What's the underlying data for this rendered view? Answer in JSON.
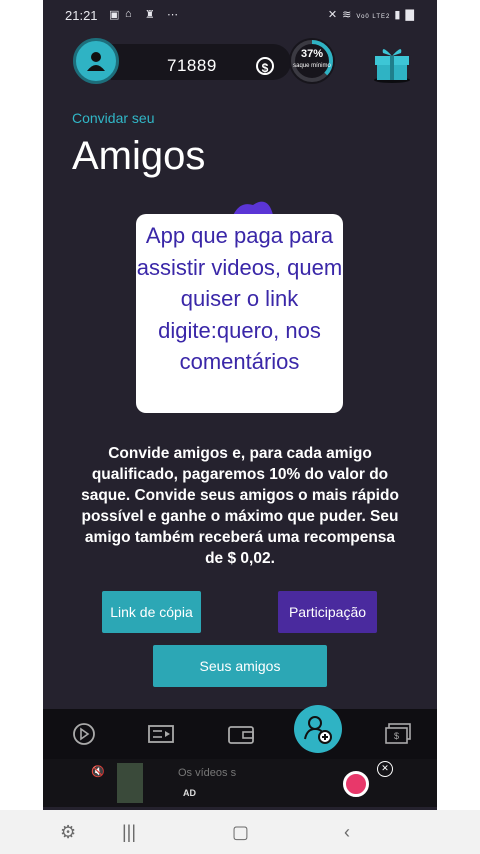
{
  "status_bar": {
    "time": "21:21",
    "notification_icons": [
      "gallery-icon",
      "vpn-icon",
      "person-icon",
      "more-icon"
    ],
    "network_label": "Vo0 LTE2",
    "system_icons": [
      "mute-icon",
      "wifi-icon",
      "signal-icon",
      "battery-icon"
    ]
  },
  "header": {
    "coin_balance": "71889",
    "currency_symbol": "$",
    "withdraw_progress": {
      "percent_label": "37%",
      "value": 0.37,
      "caption": "saque mínimo"
    }
  },
  "invite": {
    "small_title": "Convidar seu",
    "big_title": "Amigos"
  },
  "overlay_text": "App que paga para assistir videos, quem quiser o link digite:quero, nos comentários",
  "description": "Convide amigos e, para cada amigo qualificado, pagaremos 10% do valor do saque. Convide seus amigos o mais rápido possível e ganhe o máximo que puder. Seu amigo também receberá uma recompensa de $ 0,02.",
  "buttons": {
    "copy_link": "Link de cópia",
    "participation": "Participação",
    "your_friends": "Seus amigos"
  },
  "bottom_nav": {
    "items": [
      "play-icon",
      "video-list-icon",
      "wallet-icon",
      "add-friend-icon",
      "cash-icon"
    ],
    "active": "add-friend-icon"
  },
  "ad": {
    "title": "Os vídeos s",
    "label": "AD"
  },
  "colors": {
    "background": "#25222e",
    "accent_teal": "#2fb3c4",
    "accent_purple": "#4a2a9e",
    "overlay_text": "#3a27a8"
  }
}
